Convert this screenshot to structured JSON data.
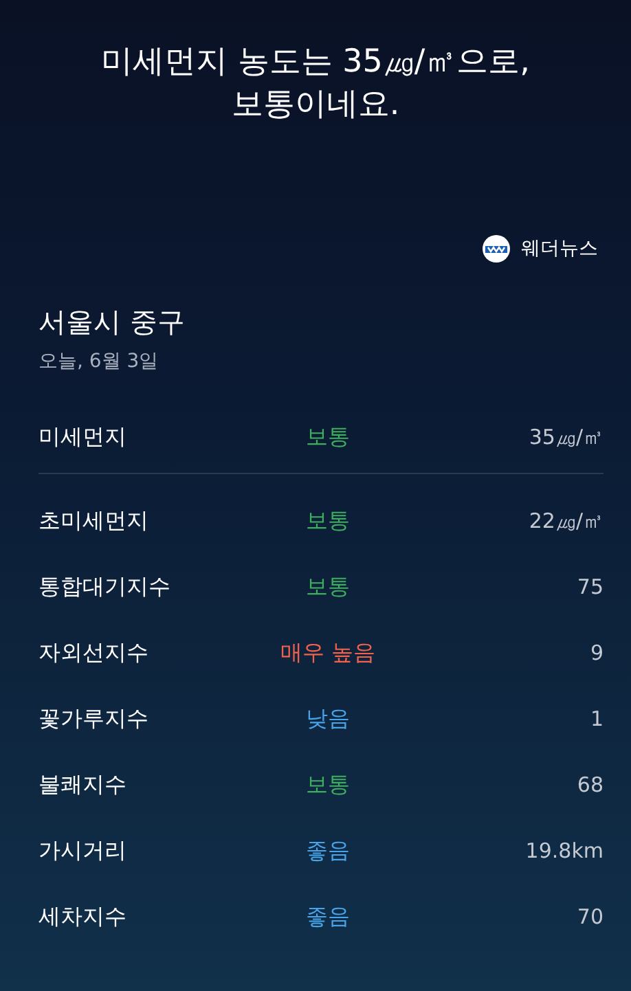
{
  "headline": {
    "lines": [
      "미세먼지 농도는 35㎍/㎥으로,",
      "보통이네요."
    ]
  },
  "source": {
    "name": "웨더뉴스"
  },
  "location": {
    "name": "서울시 중구",
    "date": "오늘, 6월 3일"
  },
  "primary": {
    "label": "미세먼지",
    "grade": "보통",
    "color": "#3dae5e",
    "value": "35㎍/㎥"
  },
  "indices": [
    {
      "label": "초미세먼지",
      "grade": "보통",
      "color": "#3dae5e",
      "value": "22㎍/㎥"
    },
    {
      "label": "통합대기지수",
      "grade": "보통",
      "color": "#3dae5e",
      "value": "75"
    },
    {
      "label": "자외선지수",
      "grade": "매우 높음",
      "color": "#f0624c",
      "value": "9"
    },
    {
      "label": "꽃가루지수",
      "grade": "낮음",
      "color": "#47a3ea",
      "value": "1"
    },
    {
      "label": "불쾌지수",
      "grade": "보통",
      "color": "#3dae5e",
      "value": "68"
    },
    {
      "label": "가시거리",
      "grade": "좋음",
      "color": "#47a3ea",
      "value": "19.8km"
    },
    {
      "label": "세차지수",
      "grade": "좋음",
      "color": "#47a3ea",
      "value": "70"
    }
  ]
}
